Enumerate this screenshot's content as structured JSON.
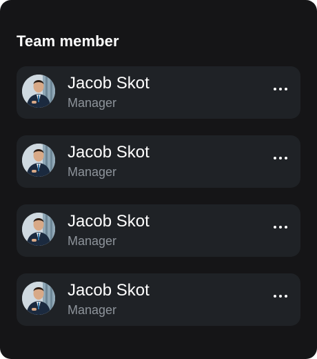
{
  "panel": {
    "title": "Team member"
  },
  "members": [
    {
      "name": "Jacob Skot",
      "role": "Manager",
      "avatar_icon": "person-avatar",
      "more_icon": "more-horizontal-icon"
    },
    {
      "name": "Jacob Skot",
      "role": "Manager",
      "avatar_icon": "person-avatar",
      "more_icon": "more-horizontal-icon"
    },
    {
      "name": "Jacob Skot",
      "role": "Manager",
      "avatar_icon": "person-avatar",
      "more_icon": "more-horizontal-icon"
    },
    {
      "name": "Jacob Skot",
      "role": "Manager",
      "avatar_icon": "person-avatar",
      "more_icon": "more-horizontal-icon"
    }
  ],
  "colors": {
    "panel_bg": "#151517",
    "row_bg": "#1f2226",
    "name_text": "#ffffff",
    "role_text": "#8e949b"
  }
}
